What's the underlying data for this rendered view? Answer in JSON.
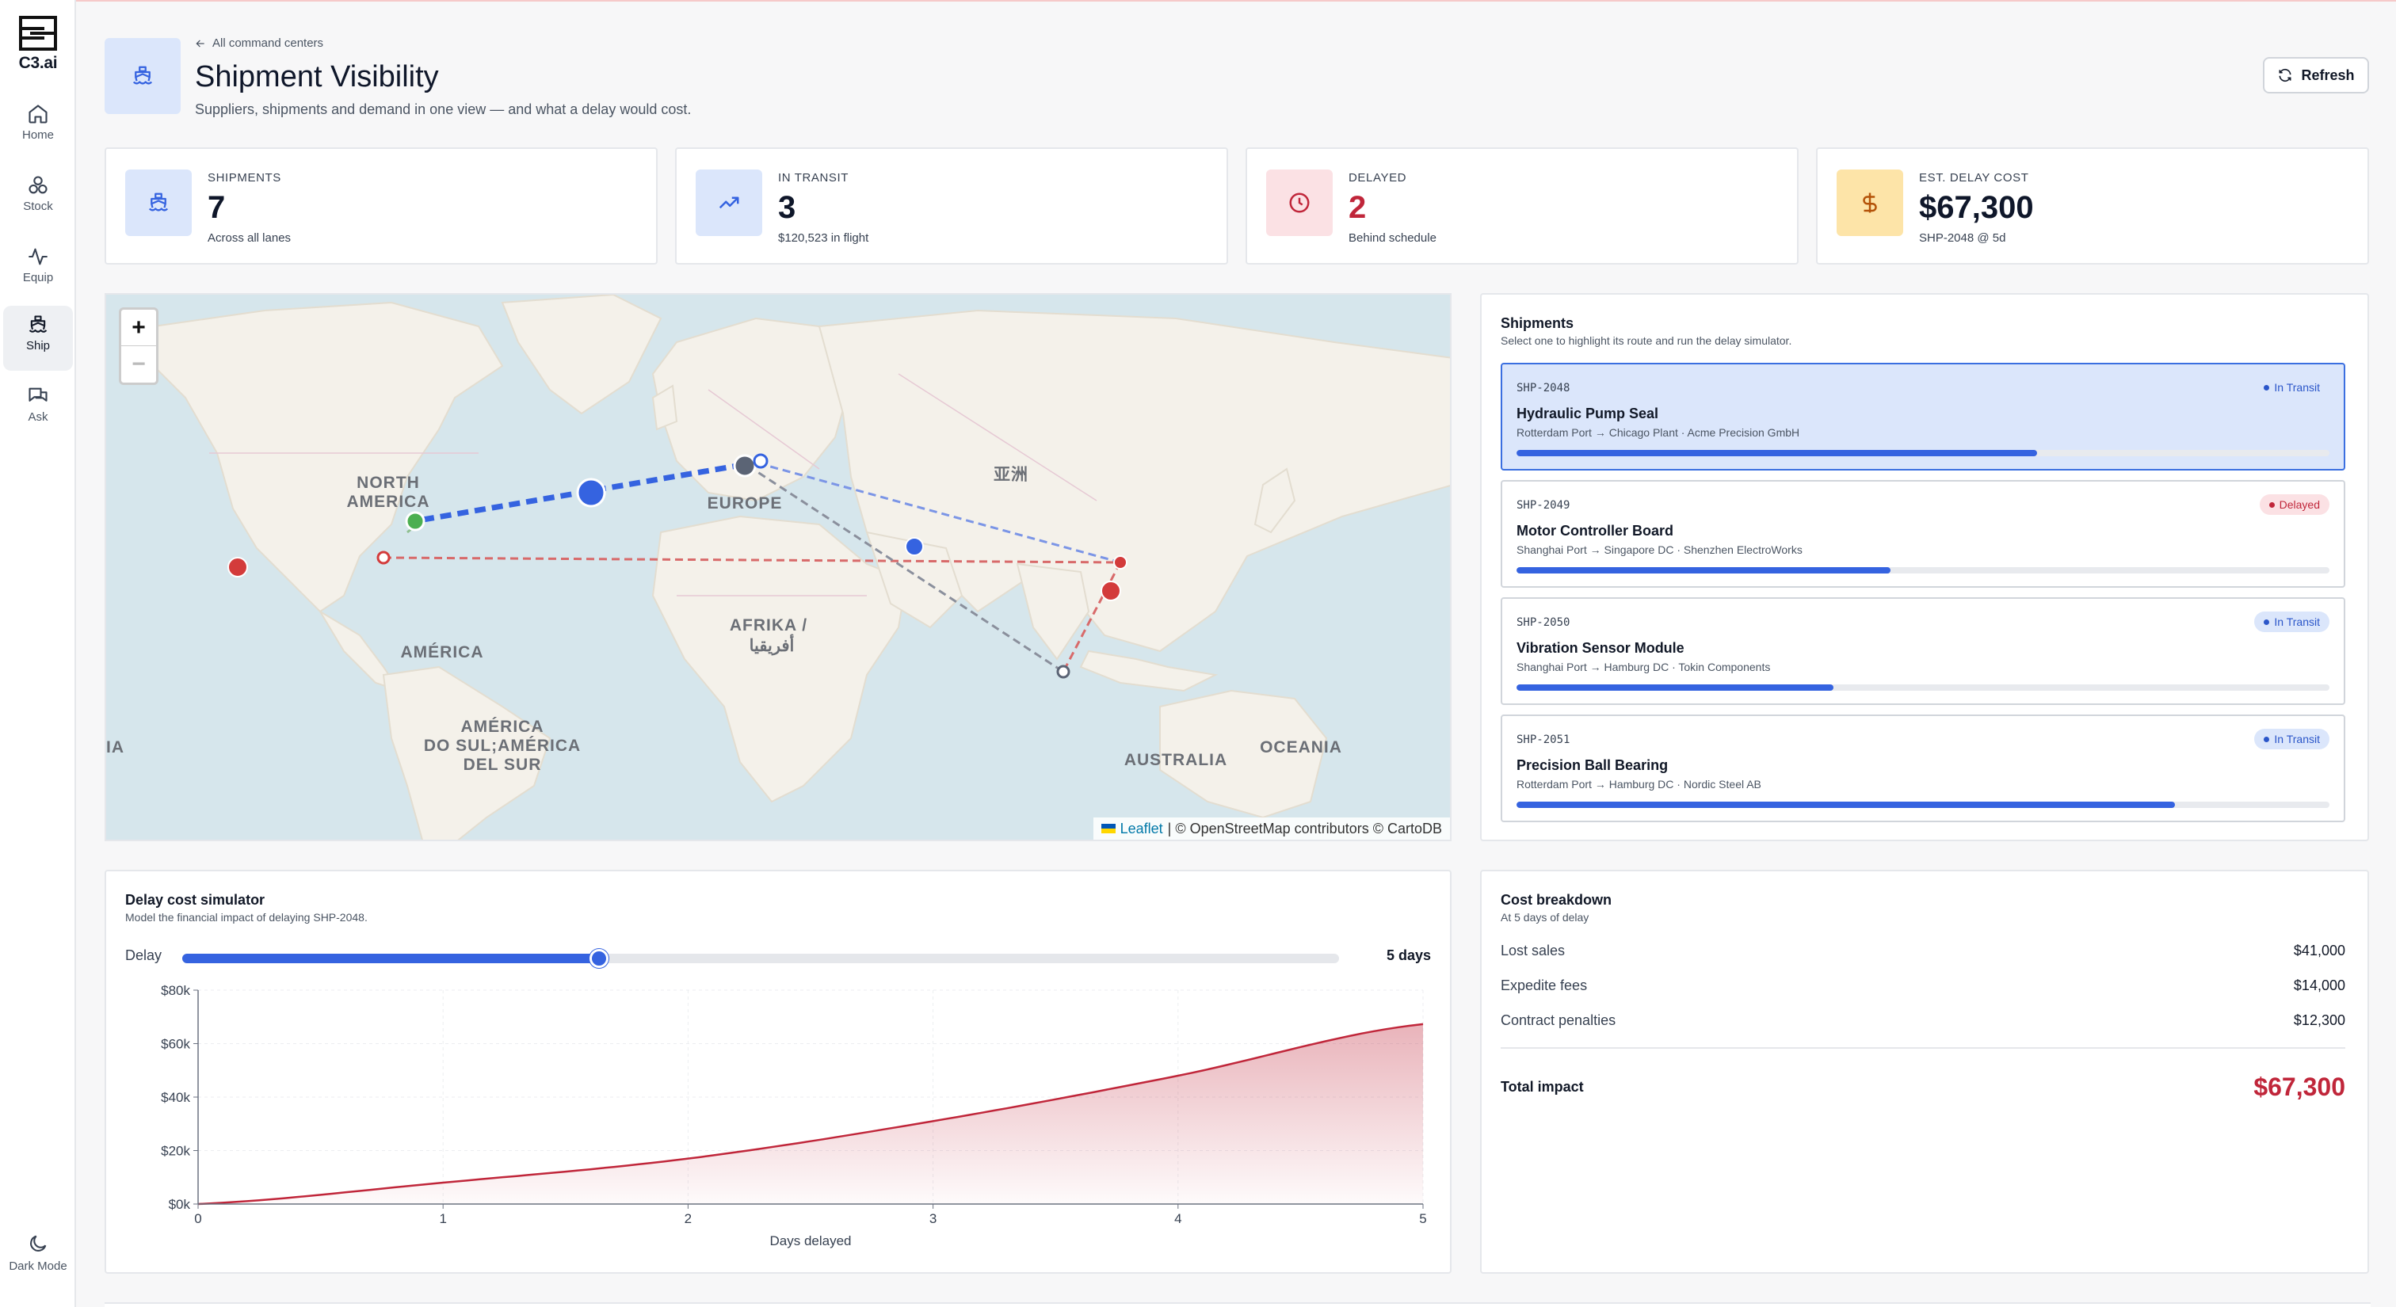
{
  "app": {
    "logo_text": "C3.ai"
  },
  "sidebar": {
    "items": [
      {
        "label": "Home",
        "icon": "home-icon"
      },
      {
        "label": "Stock",
        "icon": "stock-icon"
      },
      {
        "label": "Equip",
        "icon": "activity-icon"
      },
      {
        "label": "Ship",
        "icon": "ship-icon",
        "active": true
      },
      {
        "label": "Ask",
        "icon": "chat-icon"
      }
    ],
    "dark_mode_label": "Dark Mode"
  },
  "header": {
    "breadcrumb": "All command centers",
    "title": "Shipment Visibility",
    "subtitle": "Suppliers, shipments and demand in one view — and what a delay would cost.",
    "refresh_label": "Refresh"
  },
  "kpis": [
    {
      "label": "SHIPMENTS",
      "value": "7",
      "sub": "Across all lanes",
      "icon": "ship-icon",
      "icon_bg": "#dbe6fb",
      "icon_color": "#3563e0",
      "value_color": "#0f172a"
    },
    {
      "label": "IN TRANSIT",
      "value": "3",
      "sub": "$120,523 in flight",
      "icon": "trend-up-icon",
      "icon_bg": "#dbe6fb",
      "icon_color": "#3563e0",
      "value_color": "#0f172a"
    },
    {
      "label": "DELAYED",
      "value": "2",
      "sub": "Behind schedule",
      "icon": "clock-icon",
      "icon_bg": "#fbe1e4",
      "icon_color": "#c0263a",
      "value_color": "#c0263a"
    },
    {
      "label": "EST. DELAY COST",
      "value": "$67,300",
      "sub": "SHP-2048 @ 5d",
      "icon": "dollar-icon",
      "icon_bg": "#fde4a8",
      "icon_color": "#b45309",
      "value_color": "#0f172a"
    }
  ],
  "map": {
    "labels": {
      "north_america": "NORTH AMERICA",
      "europe": "EUROPE",
      "asia": "亚洲",
      "america": "AMÉRICA",
      "africa": "AFRIKA /",
      "africa_ar": "أفريقيا",
      "south_america": "AMÉRICA DO SUL;AMÉRICA DEL SUR",
      "australia": "AUSTRALIA",
      "oceania": "OCEANIA",
      "left_edge": "IA"
    },
    "attribution": {
      "leaflet": "Leaflet",
      "rest": "| © OpenStreetMap contributors © CartoDB"
    },
    "zoom_in": "+",
    "zoom_out": "−"
  },
  "shipments": {
    "title": "Shipments",
    "subtitle": "Select one to highlight its route and run the delay simulator.",
    "items": [
      {
        "id": "SHP-2048",
        "name": "Hydraulic Pump Seal",
        "route": "Rotterdam Port → Chicago Plant · Acme Precision GmbH",
        "status": "In Transit",
        "status_kind": "transit",
        "progress": 0.64,
        "selected": true
      },
      {
        "id": "SHP-2049",
        "name": "Motor Controller Board",
        "route": "Shanghai Port → Singapore DC · Shenzhen ElectroWorks",
        "status": "Delayed",
        "status_kind": "delayed",
        "progress": 0.46,
        "selected": false
      },
      {
        "id": "SHP-2050",
        "name": "Vibration Sensor Module",
        "route": "Shanghai Port → Hamburg DC · Tokin Components",
        "status": "In Transit",
        "status_kind": "transit",
        "progress": 0.39,
        "selected": false
      },
      {
        "id": "SHP-2051",
        "name": "Precision Ball Bearing",
        "route": "Rotterdam Port → Hamburg DC · Nordic Steel AB",
        "status": "In Transit",
        "status_kind": "transit",
        "progress": 0.81,
        "selected": false
      }
    ]
  },
  "simulator": {
    "title": "Delay cost simulator",
    "subtitle": "Model the financial impact of delaying SHP-2048.",
    "slider_label": "Delay",
    "slider_value": "5 days",
    "slider_fraction": 0.36,
    "fill_color": "#c0263a"
  },
  "chart_data": {
    "type": "area",
    "x": [
      0,
      1,
      2,
      3,
      4,
      5
    ],
    "series": [
      {
        "values": [
          0,
          8000,
          17000,
          31000,
          48000,
          67300
        ]
      }
    ],
    "xlabel": "Days delayed",
    "ylabel": "",
    "xlim": [
      0,
      5
    ],
    "ylim": [
      0,
      80000
    ],
    "yticks": [
      {
        "value": 0,
        "label": "$0k"
      },
      {
        "value": 20000,
        "label": "$20k"
      },
      {
        "value": 40000,
        "label": "$40k"
      },
      {
        "value": 60000,
        "label": "$60k"
      },
      {
        "value": 80000,
        "label": "$80k"
      }
    ],
    "xticks": [
      "0",
      "1",
      "2",
      "3",
      "4",
      "5"
    ],
    "grid": true
  },
  "cost_breakdown": {
    "title": "Cost breakdown",
    "subtitle": "At 5 days of delay",
    "rows": [
      {
        "label": "Lost sales",
        "value": "$41,000"
      },
      {
        "label": "Expedite fees",
        "value": "$14,000"
      },
      {
        "label": "Contract penalties",
        "value": "$12,300"
      }
    ],
    "total_label": "Total impact",
    "total_value": "$67,300"
  }
}
